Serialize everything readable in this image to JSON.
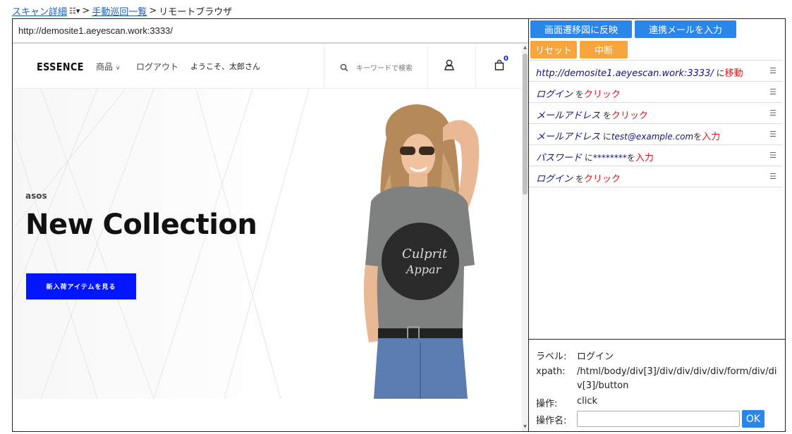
{
  "breadcrumb": {
    "scan_detail": "スキャン詳細",
    "manual_list": "手動巡回一覧",
    "sep": ">",
    "current": "リモートブラウザ"
  },
  "browser": {
    "url": "http://demosite1.aeyescan.work:3333/",
    "site": {
      "logo": "ESSENCE",
      "nav_products": "商品",
      "nav_logout": "ログアウト",
      "nav_welcome": "ようこそ、太郎さん",
      "search_placeholder": "キーワードで検索",
      "cart_count": "0",
      "hero_brand": "asos",
      "hero_title": "New Collection",
      "hero_button": "新入荷アイテムを見る"
    }
  },
  "panel": {
    "buttons": {
      "reflect": "画面遷移図に反映",
      "enter_email": "連携メールを入力",
      "reset": "リセット",
      "abort": "中断"
    },
    "steps": [
      {
        "target": "http://demosite1.aeyescan.work:3333/",
        "particle": " に",
        "action": "移動",
        "value": "",
        "suffix": ""
      },
      {
        "target": "ログイン",
        "particle": " を",
        "action": "クリック",
        "value": "",
        "suffix": ""
      },
      {
        "target": "メールアドレス",
        "particle": " を",
        "action": "クリック",
        "value": "",
        "suffix": ""
      },
      {
        "target": "メールアドレス",
        "particle": " に",
        "action": "入力",
        "value": "test@example.com",
        "suffix": "を"
      },
      {
        "target": "パスワード",
        "particle": " に",
        "action": "入力",
        "value": "********",
        "suffix": "を"
      },
      {
        "target": "ログイン",
        "particle": " を",
        "action": "クリック",
        "value": "",
        "suffix": ""
      }
    ],
    "details": {
      "label_key": "ラベル:",
      "label_val": "ログイン",
      "xpath_key": "xpath:",
      "xpath_val": "/html/body/div[3]/div/div/div/div/form/div/div[3]/button",
      "op_key": "操作:",
      "op_val": "click",
      "opname_key": "操作名:",
      "opname_value": "",
      "ok": "OK"
    }
  },
  "colors": {
    "accent_blue": "#2b86ea",
    "accent_orange": "#f6a63c",
    "site_blue": "#0315ff",
    "action_red": "#e0121b",
    "target_navy": "#11147a"
  }
}
